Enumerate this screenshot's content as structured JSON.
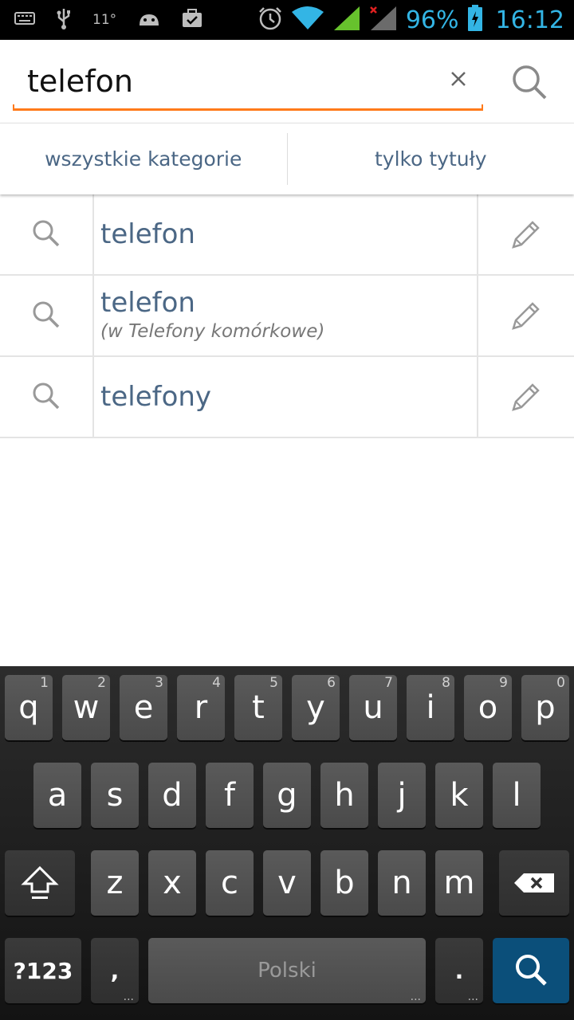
{
  "status_bar": {
    "temperature": "11°",
    "battery_percent": "96%",
    "time": "16:12",
    "icons": [
      "keyboard-icon",
      "usb-icon",
      "android-icon",
      "briefcase-check-icon",
      "alarm-icon",
      "wifi-icon",
      "signal-icon",
      "signal-no-service-icon",
      "battery-charging-icon"
    ],
    "accent_color": "#33b5e5"
  },
  "search": {
    "query": "telefon",
    "underline_color": "#ff7a1a"
  },
  "filters": {
    "category_label": "wszystkie kategorie",
    "titles_label": "tylko tytuły"
  },
  "suggestions": [
    {
      "text": "telefon",
      "subtext": ""
    },
    {
      "text": "telefon",
      "subtext": "(w Telefony komórkowe)"
    },
    {
      "text": "telefony",
      "subtext": ""
    }
  ],
  "keyboard": {
    "row1": [
      {
        "label": "q",
        "hint": "1"
      },
      {
        "label": "w",
        "hint": "2"
      },
      {
        "label": "e",
        "hint": "3"
      },
      {
        "label": "r",
        "hint": "4"
      },
      {
        "label": "t",
        "hint": "5"
      },
      {
        "label": "y",
        "hint": "6"
      },
      {
        "label": "u",
        "hint": "7"
      },
      {
        "label": "i",
        "hint": "8"
      },
      {
        "label": "o",
        "hint": "9"
      },
      {
        "label": "p",
        "hint": "0"
      }
    ],
    "row2": [
      "a",
      "s",
      "d",
      "f",
      "g",
      "h",
      "j",
      "k",
      "l"
    ],
    "row3": [
      "z",
      "x",
      "c",
      "v",
      "b",
      "n",
      "m"
    ],
    "symbols_label": "?123",
    "comma_label": ",",
    "space_label": "Polski",
    "period_label": ".",
    "enter_color": "#0b4f7a"
  }
}
